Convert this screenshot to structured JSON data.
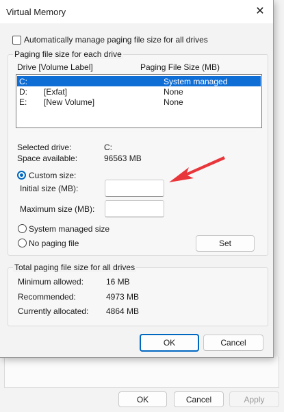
{
  "dialog": {
    "title": "Virtual Memory",
    "auto_manage_label": "Automatically manage paging file size for all drives",
    "paging_group_title": "Paging file size for each drive",
    "columns": {
      "drive": "Drive  [Volume Label]",
      "size": "Paging File Size (MB)"
    },
    "drives": [
      {
        "drive": "C:",
        "label": "",
        "size": "System managed",
        "selected": true
      },
      {
        "drive": "D:",
        "label": "[Exfat]",
        "size": "None",
        "selected": false
      },
      {
        "drive": "E:",
        "label": "[New Volume]",
        "size": "None",
        "selected": false
      }
    ],
    "selected_drive_label": "Selected drive:",
    "selected_drive_value": "C:",
    "space_available_label": "Space available:",
    "space_available_value": "96563 MB",
    "custom_size_label": "Custom size:",
    "initial_size_label": "Initial size (MB):",
    "initial_size_value": "",
    "max_size_label": "Maximum size (MB):",
    "max_size_value": "",
    "system_managed_label": "System managed size",
    "no_paging_label": "No paging file",
    "set_label": "Set",
    "total_group_title": "Total paging file size for all drives",
    "minimum_label": "Minimum allowed:",
    "minimum_value": "16 MB",
    "recommended_label": "Recommended:",
    "recommended_value": "4973 MB",
    "allocated_label": "Currently allocated:",
    "allocated_value": "4864 MB",
    "ok_label": "OK",
    "cancel_label": "Cancel"
  },
  "parent": {
    "ok_label": "OK",
    "cancel_label": "Cancel",
    "apply_label": "Apply"
  },
  "colors": {
    "accent": "#0067c0",
    "selection": "#0f6ed6",
    "arrow": "#e8363a"
  }
}
